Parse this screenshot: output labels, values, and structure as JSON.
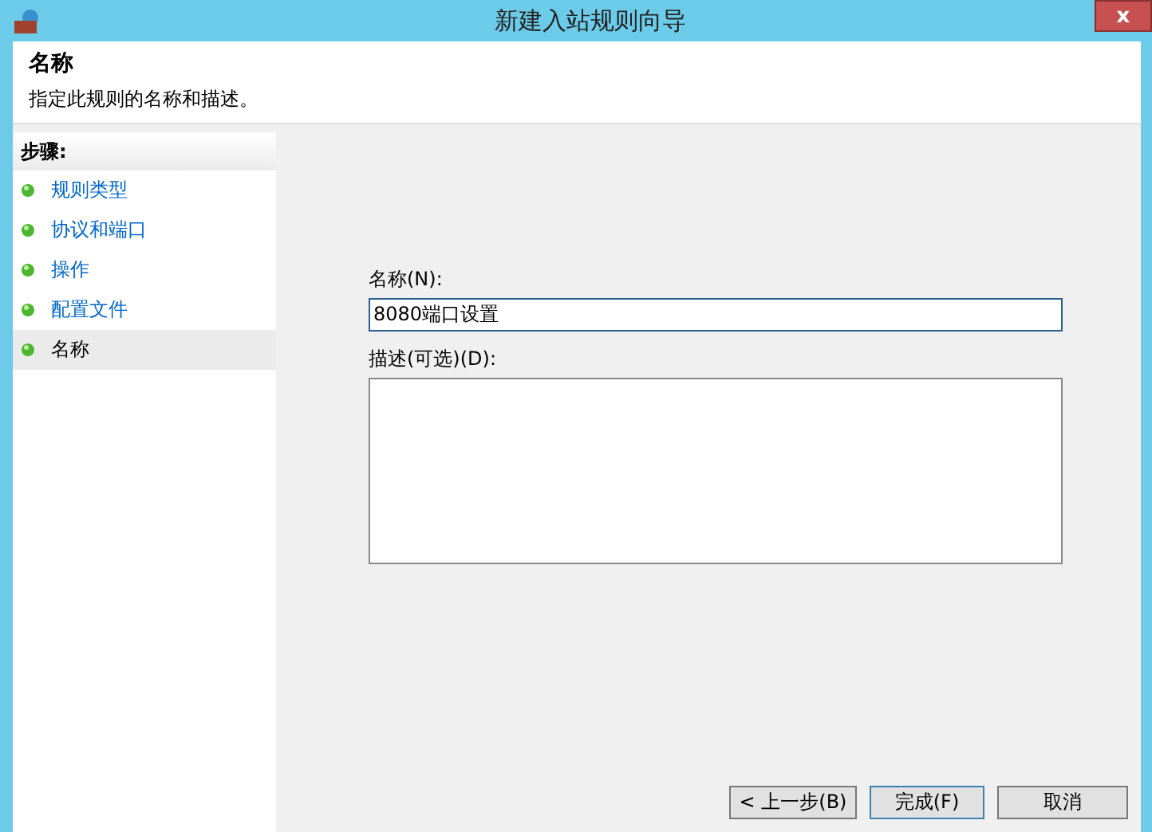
{
  "window": {
    "title": "新建入站规则向导",
    "close": "x"
  },
  "header": {
    "title": "名称",
    "description": "指定此规则的名称和描述。"
  },
  "steps": {
    "heading": "步骤:",
    "items": [
      {
        "label": "规则类型",
        "selected": false
      },
      {
        "label": "协议和端口",
        "selected": false
      },
      {
        "label": "操作",
        "selected": false
      },
      {
        "label": "配置文件",
        "selected": false
      },
      {
        "label": "名称",
        "selected": true
      }
    ]
  },
  "form": {
    "name_label": "名称(N):",
    "name_value": "8080端口设置",
    "description_label": "描述(可选)(D):"
  },
  "buttons": [
    {
      "label": "< 上一步(B)",
      "default": false
    },
    {
      "label": "完成(F)",
      "default": true
    },
    {
      "label": "取消",
      "default": false
    }
  ]
}
